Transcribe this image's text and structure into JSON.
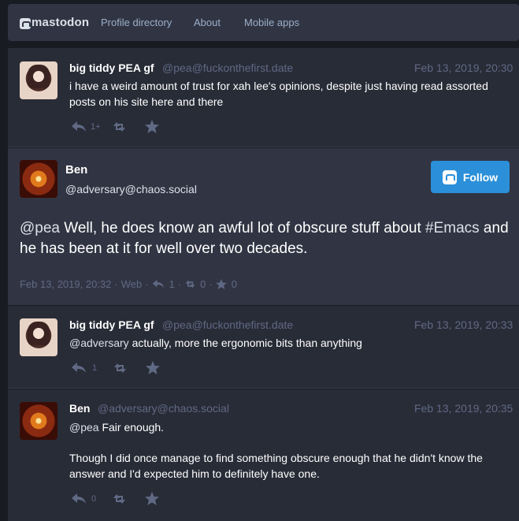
{
  "header": {
    "logo_text": "mastodon",
    "nav": [
      "Profile directory",
      "About",
      "Mobile apps"
    ]
  },
  "statuses": [
    {
      "display_name": "big tiddy PEA gf",
      "acct": "@pea@fuckonthefirst.date",
      "time": "Feb 13, 2019, 20:30",
      "content": "i have a weird amount of trust for xah lee's opinions, despite just having read assorted posts on his site here and there",
      "reply_count": "1+"
    },
    {
      "display_name": "big tiddy PEA gf",
      "acct": "@pea@fuckonthefirst.date",
      "time": "Feb 13, 2019, 20:33",
      "mention": "@adversary",
      "content": " actually, more the ergonomic bits than anything",
      "reply_count": "1"
    },
    {
      "display_name": "Ben",
      "acct": "@adversary@chaos.social",
      "time": "Feb 13, 2019, 20:35",
      "mention": "@pea",
      "content": " Fair enough.",
      "content2": "Though I did once manage to find something obscure enough that he didn't know the answer and I'd expected him to definitely have one.",
      "reply_count": "0"
    }
  ],
  "focus": {
    "display_name": "Ben",
    "acct": "@adversary@chaos.social",
    "follow_label": "Follow",
    "mention": "@pea",
    "content_a": " Well, he does know an awful lot of obscure stuff about ",
    "hashtag": "#Emacs",
    "content_b": " and he has been at it for well over two decades.",
    "time": "Feb 13, 2019, 20:32",
    "app": "Web",
    "replies": "1",
    "boosts": "0",
    "favs": "0"
  },
  "colors": {
    "background": "#191b22",
    "card": "#282c37",
    "focus_card": "#313543",
    "muted": "#606984",
    "accent": "#2b90d9"
  }
}
